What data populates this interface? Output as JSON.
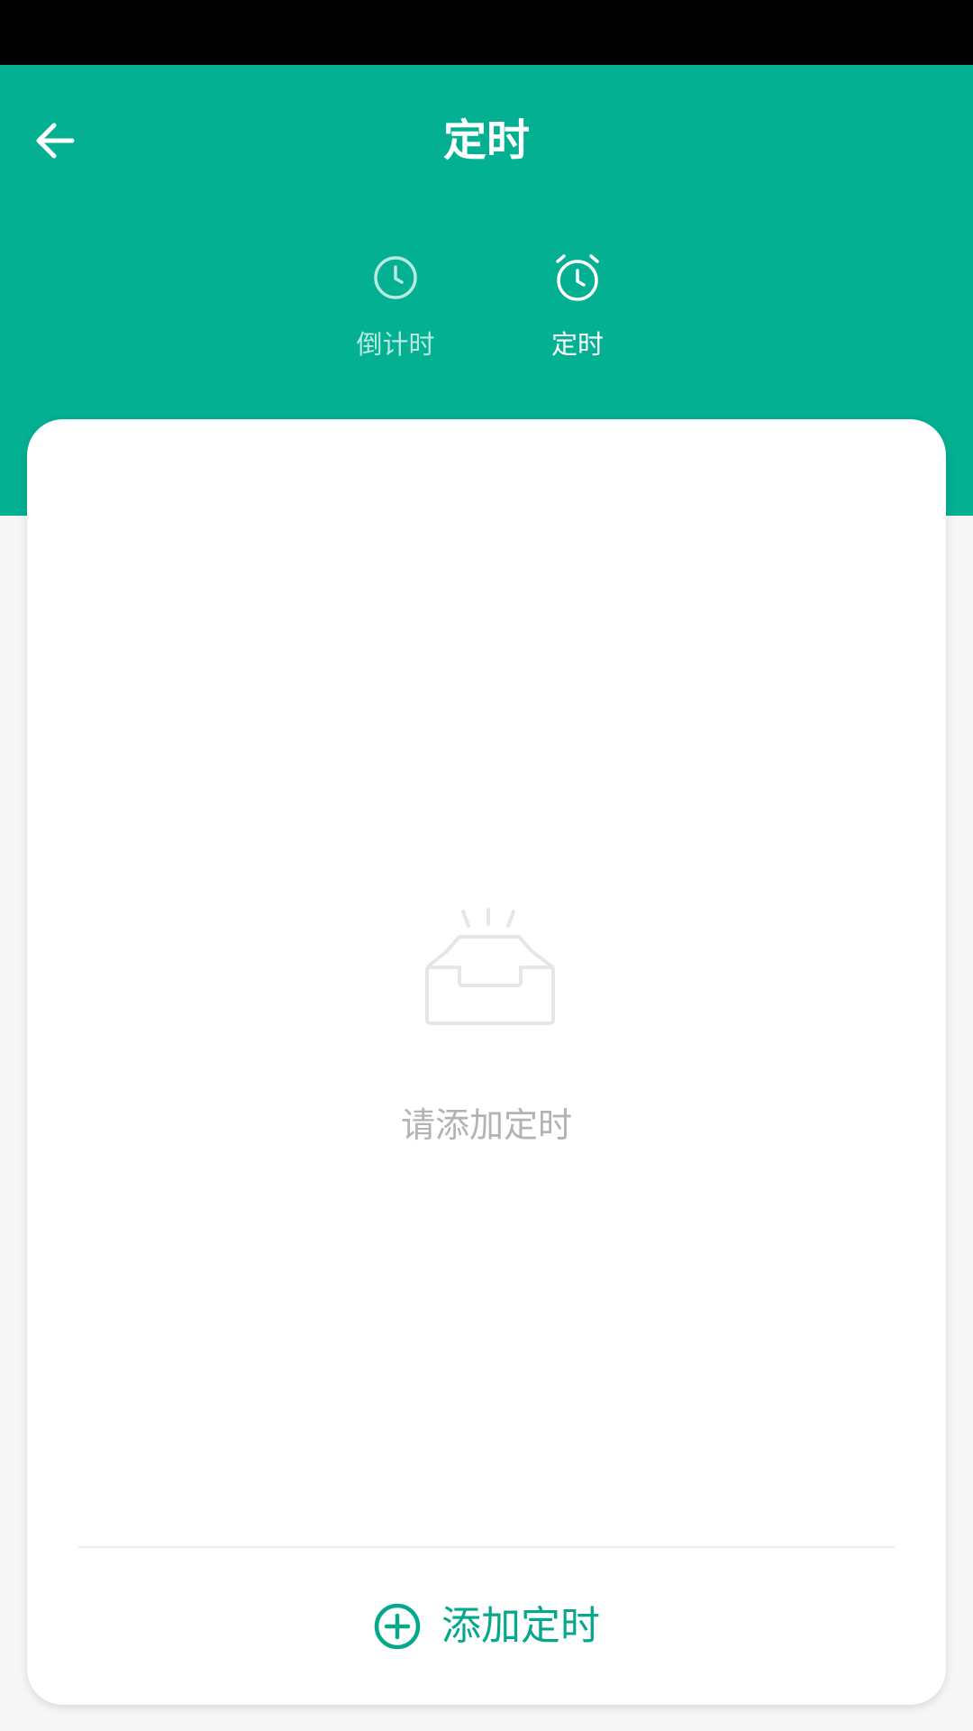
{
  "header": {
    "title": "定时",
    "back_icon": "arrow-left-icon",
    "background_color": "#04b092"
  },
  "tabs": [
    {
      "label": "倒计时",
      "icon": "clock-icon",
      "active": false
    },
    {
      "label": "定时",
      "icon": "alarm-clock-icon",
      "active": true
    }
  ],
  "empty_state": {
    "icon": "empty-inbox-icon",
    "message": "请添加定时"
  },
  "add_button": {
    "icon": "plus-circle-icon",
    "label": "添加定时",
    "color": "#04a88b"
  }
}
